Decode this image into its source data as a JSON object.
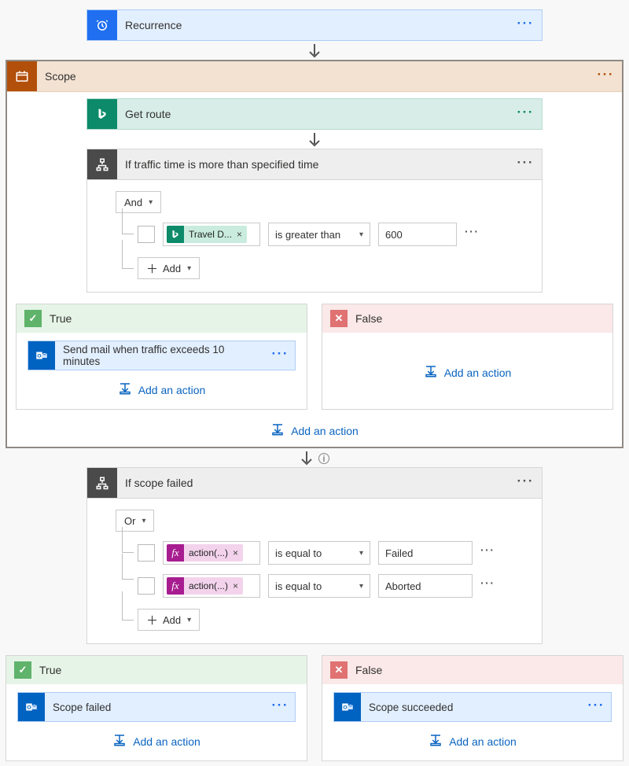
{
  "recurrence": {
    "title": "Recurrence"
  },
  "scope": {
    "title": "Scope",
    "getRoute": {
      "title": "Get route"
    },
    "condition": {
      "title": "If traffic time is more than specified time",
      "joiner": "And",
      "row": {
        "tokenLabel": "Travel D...",
        "operator": "is greater than",
        "value": "600"
      },
      "addLabel": "Add"
    },
    "trueBranch": {
      "label": "True",
      "action": {
        "title": "Send mail when traffic exceeds 10 minutes"
      }
    },
    "falseBranch": {
      "label": "False"
    },
    "addAction": "Add an action"
  },
  "scopeFailed": {
    "title": "If scope failed",
    "joiner": "Or",
    "rows": [
      {
        "tokenLabel": "action(...)",
        "operator": "is equal to",
        "value": "Failed"
      },
      {
        "tokenLabel": "action(...)",
        "operator": "is equal to",
        "value": "Aborted"
      }
    ],
    "addLabel": "Add"
  },
  "bottomTrue": {
    "label": "True",
    "action": {
      "title": "Scope failed"
    }
  },
  "bottomFalse": {
    "label": "False",
    "action": {
      "title": "Scope succeeded"
    }
  },
  "common": {
    "addAction": "Add an action"
  }
}
